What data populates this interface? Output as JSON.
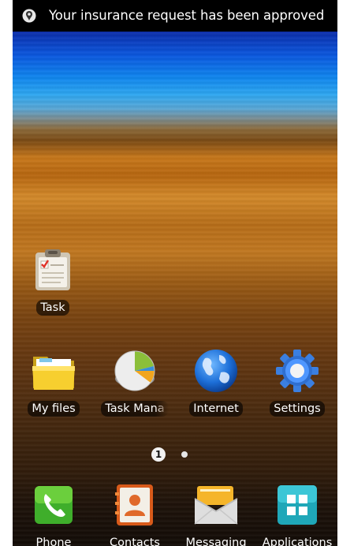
{
  "status_bar": {
    "notification_icon": "notification-icon",
    "text": "Your insurance request has been approved"
  },
  "home_apps": [
    {
      "label": "Task",
      "icon": "task-clipboard-icon"
    },
    {
      "label": "My files",
      "icon": "folder-icon"
    },
    {
      "label": "Task Mana",
      "icon": "pie-chart-icon"
    },
    {
      "label": "Internet",
      "icon": "globe-icon"
    },
    {
      "label": "Settings",
      "icon": "gear-icon"
    }
  ],
  "page_indicator": {
    "current_page": "1",
    "total_pages": 2
  },
  "dock_apps": [
    {
      "label": "Phone",
      "icon": "phone-icon"
    },
    {
      "label": "Contacts",
      "icon": "contacts-icon"
    },
    {
      "label": "Messaging",
      "icon": "envelope-icon"
    },
    {
      "label": "Applications",
      "icon": "grid-icon"
    }
  ]
}
